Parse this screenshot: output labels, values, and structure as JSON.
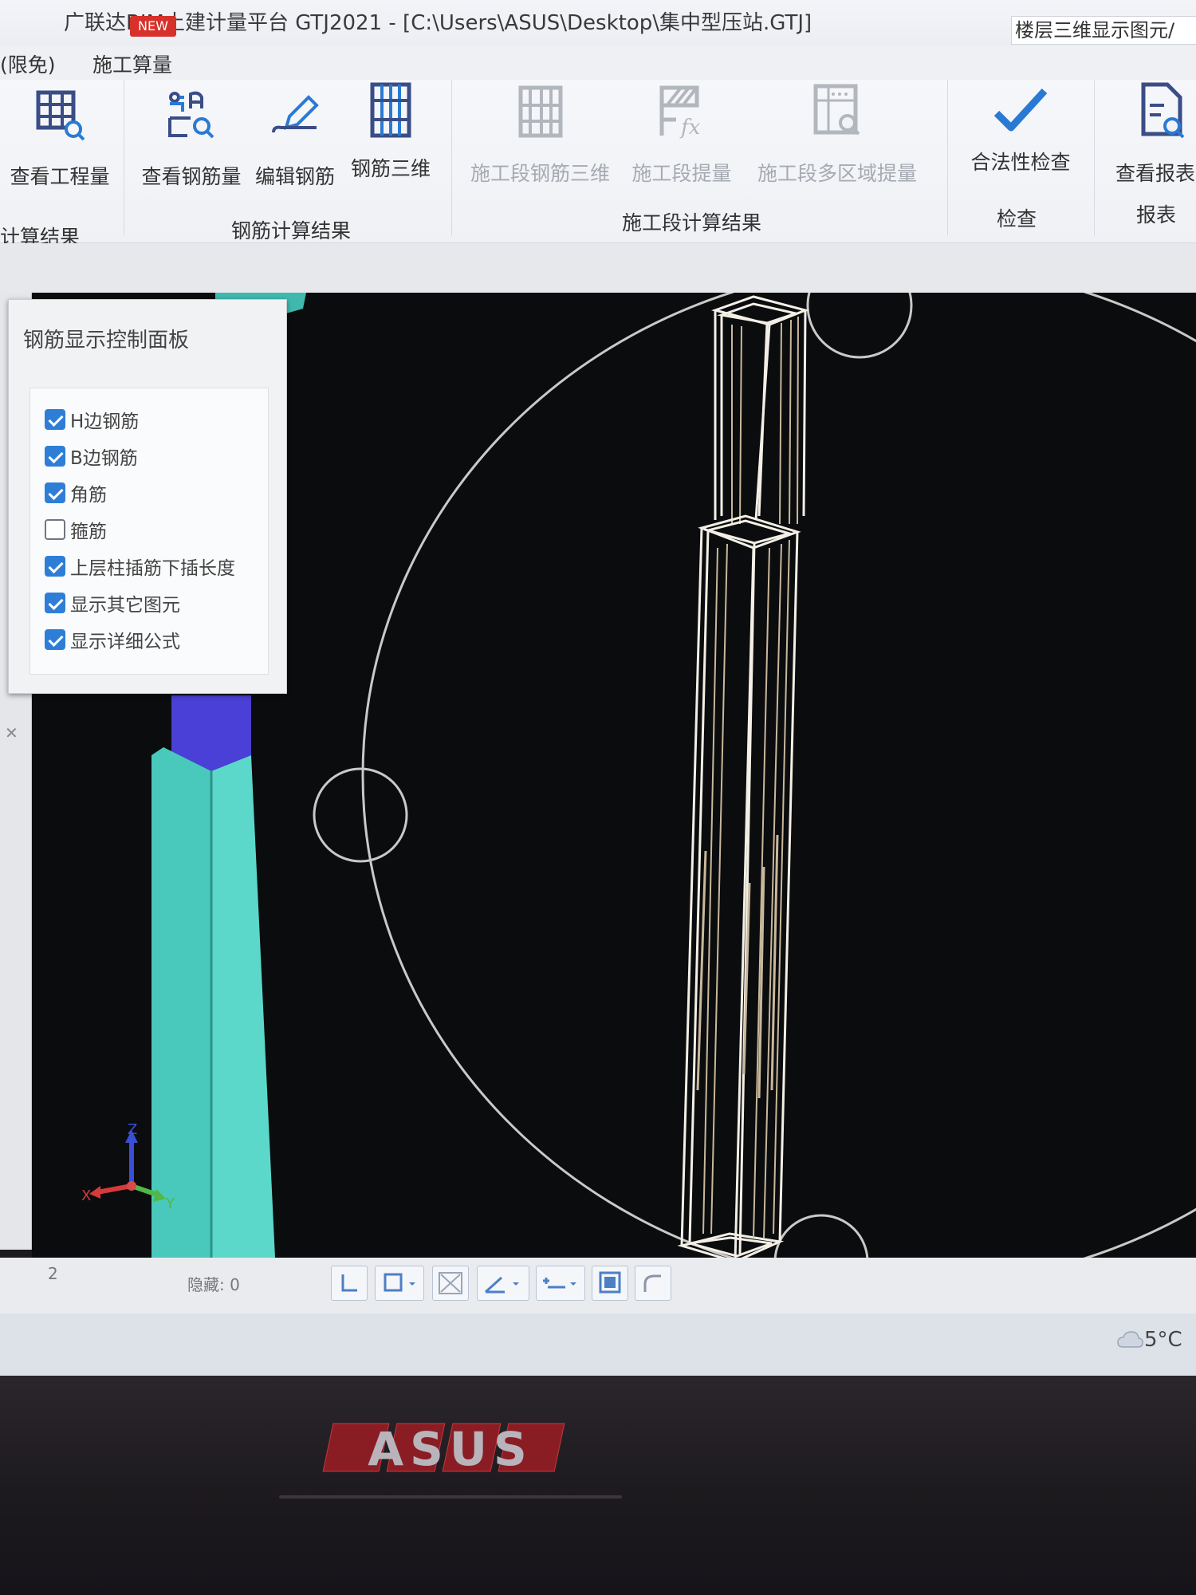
{
  "window": {
    "title": "广联达BIM土建计量平台 GTJ2021 - [C:\\Users\\ASUS\\Desktop\\集中型压站.GTJ]",
    "new_badge": "NEW",
    "right_field": "楼层三维显示图元/"
  },
  "menu": {
    "items": [
      "(限免)",
      "施工算量"
    ]
  },
  "ribbon": {
    "buttons": [
      {
        "label": "查看工程量",
        "icon": "grid-search-icon",
        "enabled": true
      },
      {
        "label": "查看钢筋量",
        "icon": "rebar-search-icon",
        "enabled": true
      },
      {
        "label": "编辑钢筋",
        "icon": "pencil-icon",
        "enabled": true
      },
      {
        "label": "钢筋三维",
        "icon": "rebar-3d-icon",
        "enabled": true
      },
      {
        "label": "施工段钢筋三维",
        "icon": "stage-rebar-3d-icon",
        "enabled": false
      },
      {
        "label": "施工段提量",
        "icon": "stage-formula-icon",
        "enabled": false
      },
      {
        "label": "施工段多区域提量",
        "icon": "stage-multi-area-icon",
        "enabled": false
      },
      {
        "label": "合法性检查",
        "icon": "checkmark-icon",
        "enabled": true
      },
      {
        "label": "查看报表",
        "icon": "report-search-icon",
        "enabled": true
      }
    ],
    "groups": [
      "计算结果",
      "钢筋计算结果",
      "施工段计算结果",
      "检查",
      "报表"
    ]
  },
  "panel": {
    "title": "钢筋显示控制面板",
    "options": [
      {
        "label": "H边钢筋",
        "checked": true
      },
      {
        "label": "B边钢筋",
        "checked": true
      },
      {
        "label": "角筋",
        "checked": true
      },
      {
        "label": "箍筋",
        "checked": false
      },
      {
        "label": "上层柱插筋下插长度",
        "checked": true
      },
      {
        "label": "显示其它图元",
        "checked": true
      },
      {
        "label": "显示详细公式",
        "checked": true
      }
    ]
  },
  "viewport": {
    "axes": {
      "x": "X",
      "y": "Y",
      "z": "Z"
    },
    "colors": {
      "background": "#0b0c0e",
      "column_outline": "#f3efe6",
      "orbit_circle": "#c9c9c9",
      "cyan_element": "#49c9bb",
      "blue_element": "#4a3fd6"
    }
  },
  "status": {
    "number": "2",
    "hidden_label": "隐藏: 0",
    "temperature": "5°C"
  },
  "bezel": {
    "brand": "ASUS"
  }
}
